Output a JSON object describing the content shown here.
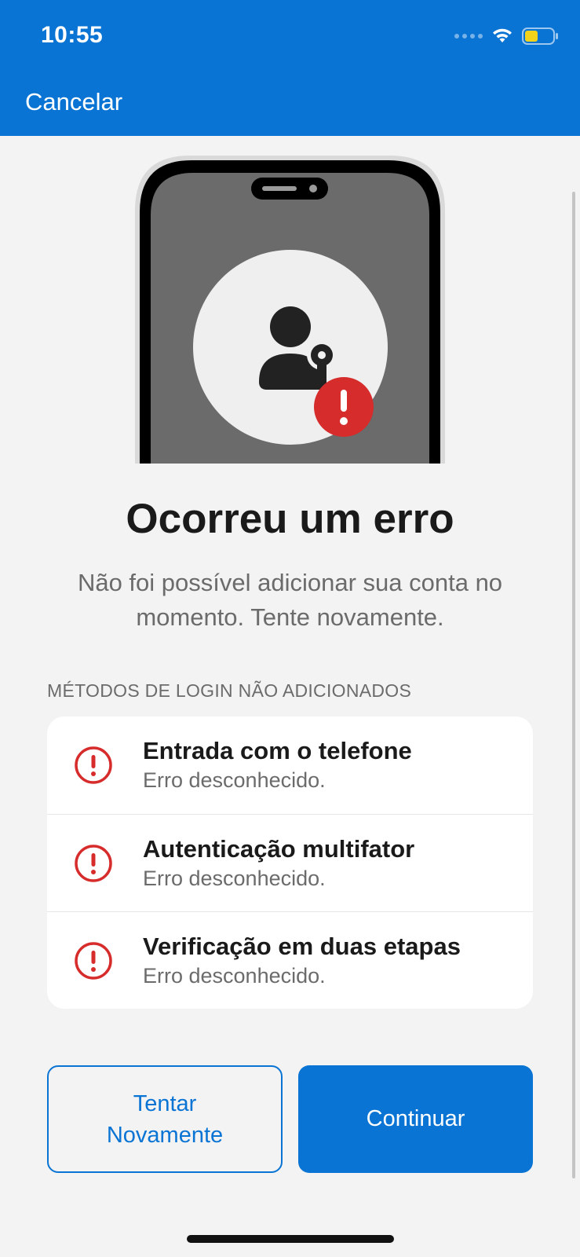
{
  "status_bar": {
    "time": "10:55",
    "icons": [
      "signal-dots-icon",
      "wifi-icon",
      "battery-icon"
    ],
    "battery_color": "#f2d21b"
  },
  "nav": {
    "cancel_label": "Cancelar"
  },
  "illustration": {
    "icons": [
      "phone-illustration",
      "user-key-icon",
      "error-badge-icon"
    ],
    "error_color": "#d62c2c"
  },
  "main": {
    "title": "Ocorreu um erro",
    "subtitle_line1": "Não foi possível adicionar sua conta no",
    "subtitle_line2": "momento. Tente novamente."
  },
  "methods": {
    "header": "MÉTODOS DE LOGIN NÃO ADICIONADOS",
    "items": [
      {
        "title": "Entrada com o telefone",
        "status": "Erro desconhecido.",
        "icon": "error-circle-icon"
      },
      {
        "title": "Autenticação multifator",
        "status": "Erro desconhecido.",
        "icon": "error-circle-icon"
      },
      {
        "title": "Verificação em duas etapas",
        "status": "Erro desconhecido.",
        "icon": "error-circle-icon"
      }
    ]
  },
  "buttons": {
    "retry_line1": "Tentar",
    "retry_line2": "Novamente",
    "continue_label": "Continuar"
  },
  "colors": {
    "accent": "#0a74d4",
    "background": "#f3f3f3",
    "error": "#d62c2c"
  }
}
